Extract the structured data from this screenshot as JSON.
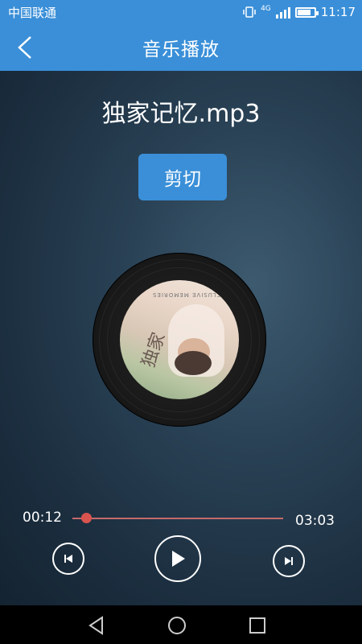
{
  "status": {
    "carrier": "中国联通",
    "network": "4G",
    "time": "11:17",
    "battery_level": 0.85
  },
  "header": {
    "title": "音乐播放",
    "back_icon": "chevron-left-icon"
  },
  "player": {
    "song_title": "独家记忆.mp3",
    "cut_label": "剪切",
    "current_time": "00:12",
    "total_time": "03:03",
    "progress": 0.066,
    "cover_script": "独家",
    "cover_text": "EXCLUSIVE MEMORIES"
  },
  "colors": {
    "accent": "#3a8fd8",
    "progress": "#d9534f"
  }
}
